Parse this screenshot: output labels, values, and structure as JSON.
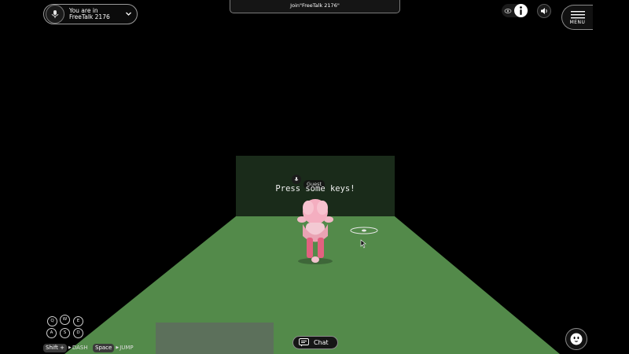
{
  "room": {
    "line1": "You are in",
    "line2": "FreeTalk 2176"
  },
  "join_banner": "Join\"FreeTalk 2176\"",
  "menu_label": "MENU",
  "scene": {
    "press_text": "Press some keys!",
    "player_name": "Guest",
    "floor_color": "#538a4a",
    "wall_color": "#1a2b1a"
  },
  "controls": {
    "keys": [
      "Q",
      "W",
      "E",
      "A",
      "S",
      "D"
    ],
    "dash_key": "Shift +",
    "dash_action": "DASH",
    "jump_key": "Space",
    "jump_action": "JUMP"
  },
  "chat_label": "Chat",
  "icons": {
    "room_logo": "mic-person-icon",
    "visibility": "eye-icon",
    "info": "info-icon",
    "sound": "speaker-icon",
    "menu": "hamburger-icon",
    "emote": "smiley-icon",
    "chat": "chat-bubble-icon"
  }
}
